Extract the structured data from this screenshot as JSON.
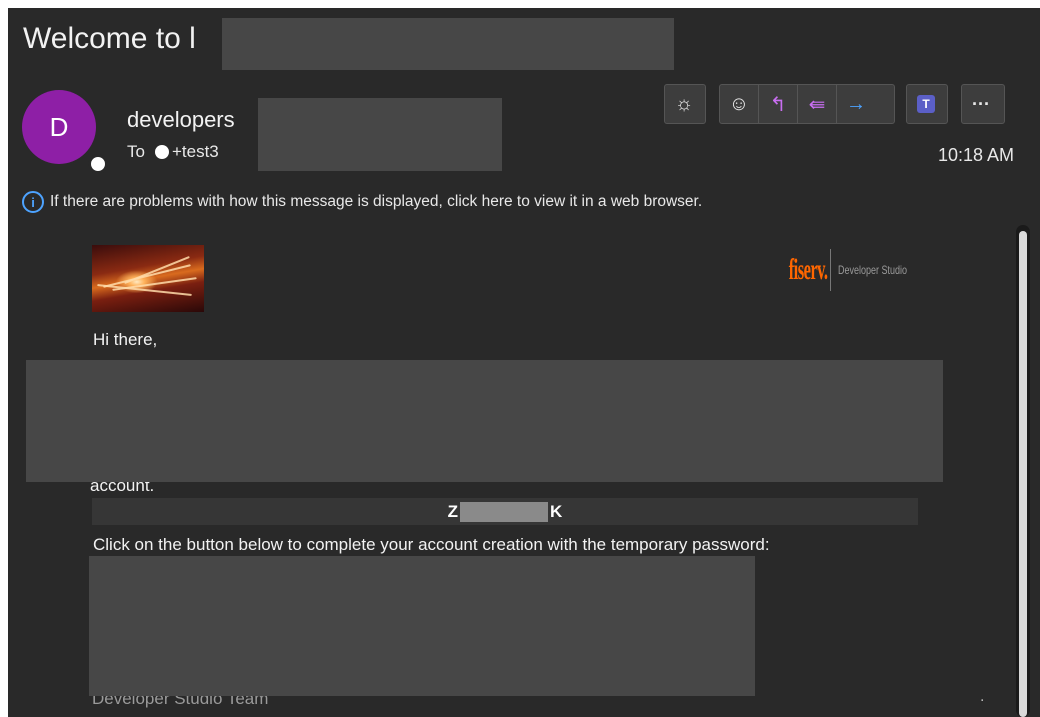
{
  "email": {
    "subject": "Welcome to l",
    "sender": {
      "name": "developers",
      "avatar_initial": "D",
      "avatar_color": "#8e1fa6"
    },
    "to_label": "To",
    "recipient": "+test3",
    "time": "10:18 AM"
  },
  "toolbar": {
    "brightness_icon": "☼",
    "react_icon": "☺",
    "reply_icon": "↰",
    "reply_all_icon": "⇚",
    "forward_icon": "→",
    "teams_icon": "T",
    "more_icon": "···"
  },
  "info_bar": {
    "icon": "i",
    "text": "If there are problems with how this message is displayed, click here to view it in a web browser."
  },
  "message": {
    "logo_brand": "fiserv.",
    "logo_sub": "Developer Studio",
    "greeting": "Hi there,",
    "partial_line": "account.",
    "code_start": "Z",
    "code_end": "K",
    "instruction": "Click on the button below to complete your account creation with the temporary password:",
    "signoff": "Developer Studio Team"
  },
  "colors": {
    "accent": "#4da3ff",
    "brand": "#ff6600",
    "background": "#292929"
  }
}
